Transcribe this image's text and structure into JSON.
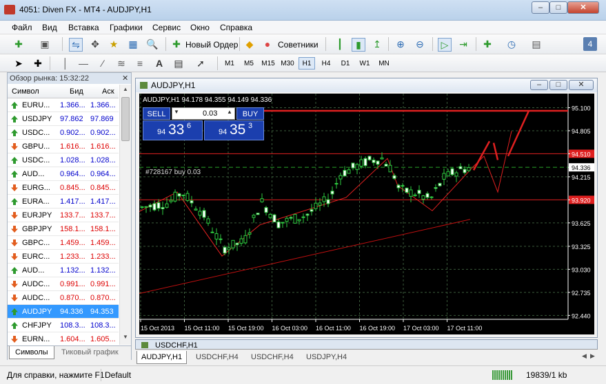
{
  "window": {
    "title": "4051: Diven FX - MT4 - AUDJPY,H1"
  },
  "menu": [
    "Файл",
    "Вид",
    "Вставка",
    "Графики",
    "Сервис",
    "Окно",
    "Справка"
  ],
  "toolbar": {
    "new_order": "Новый Ордер",
    "advisors": "Советники",
    "badge": "4"
  },
  "timeframes": [
    "M1",
    "M5",
    "M15",
    "M30",
    "H1",
    "H4",
    "D1",
    "W1",
    "MN"
  ],
  "active_timeframe": "H1",
  "market_watch": {
    "title": "Обзор рынка: 15:32:22",
    "headers": {
      "symbol": "Символ",
      "bid": "Бид",
      "ask": "Аск"
    },
    "rows": [
      {
        "symbol": "EURU...",
        "bid": "1.366...",
        "ask": "1.366...",
        "dir": "up",
        "color": "#0000cc"
      },
      {
        "symbol": "USDJPY",
        "bid": "97.862",
        "ask": "97.869",
        "dir": "up",
        "color": "#0000cc"
      },
      {
        "symbol": "USDC...",
        "bid": "0.902...",
        "ask": "0.902...",
        "dir": "up",
        "color": "#0000cc"
      },
      {
        "symbol": "GBPU...",
        "bid": "1.616...",
        "ask": "1.616...",
        "dir": "down",
        "color": "#dd0000"
      },
      {
        "symbol": "USDC...",
        "bid": "1.028...",
        "ask": "1.028...",
        "dir": "up",
        "color": "#0000cc"
      },
      {
        "symbol": "AUD...",
        "bid": "0.964...",
        "ask": "0.964...",
        "dir": "up",
        "color": "#0000cc"
      },
      {
        "symbol": "EURG...",
        "bid": "0.845...",
        "ask": "0.845...",
        "dir": "down",
        "color": "#dd0000"
      },
      {
        "symbol": "EURA...",
        "bid": "1.417...",
        "ask": "1.417...",
        "dir": "up",
        "color": "#0000cc"
      },
      {
        "symbol": "EURJPY",
        "bid": "133.7...",
        "ask": "133.7...",
        "dir": "down",
        "color": "#dd0000"
      },
      {
        "symbol": "GBPJPY",
        "bid": "158.1...",
        "ask": "158.1...",
        "dir": "down",
        "color": "#dd0000"
      },
      {
        "symbol": "GBPC...",
        "bid": "1.459...",
        "ask": "1.459...",
        "dir": "down",
        "color": "#dd0000"
      },
      {
        "symbol": "EURC...",
        "bid": "1.233...",
        "ask": "1.233...",
        "dir": "down",
        "color": "#dd0000"
      },
      {
        "symbol": "AUD...",
        "bid": "1.132...",
        "ask": "1.132...",
        "dir": "up",
        "color": "#0000cc"
      },
      {
        "symbol": "AUDC...",
        "bid": "0.991...",
        "ask": "0.991...",
        "dir": "down",
        "color": "#dd0000"
      },
      {
        "symbol": "AUDC...",
        "bid": "0.870...",
        "ask": "0.870...",
        "dir": "down",
        "color": "#dd0000"
      },
      {
        "symbol": "AUDJPY",
        "bid": "94.336",
        "ask": "94.353",
        "dir": "up",
        "color": "#ffffff",
        "selected": true
      },
      {
        "symbol": "CHFJPY",
        "bid": "108.3...",
        "ask": "108.3...",
        "dir": "up",
        "color": "#0000cc"
      },
      {
        "symbol": "EURN...",
        "bid": "1.604...",
        "ask": "1.605...",
        "dir": "down",
        "color": "#dd0000"
      }
    ],
    "tabs": [
      "Символы",
      "Тиковый график"
    ]
  },
  "chart": {
    "window_title": "AUDJPY,H1",
    "info": "AUDJPY,H1  94.178 94.355 94.149 94.336",
    "sell_label": "SELL",
    "buy_label": "BUY",
    "lot": "0.03",
    "sell_price_prefix": "94",
    "sell_price_big": "33",
    "sell_price_sup": "6",
    "buy_price_prefix": "94",
    "buy_price_big": "35",
    "buy_price_sup": "3",
    "order_label": "#728167 buy 0.03",
    "price_labels": [
      "95.100",
      "94.805",
      "94.510",
      "94.336",
      "94.215",
      "93.920",
      "93.625",
      "93.325",
      "93.030",
      "92.735",
      "92.440"
    ],
    "time_labels": [
      "15 Oct 2013",
      "15 Oct 11:00",
      "15 Oct 19:00",
      "16 Oct 03:00",
      "16 Oct 11:00",
      "16 Oct 19:00",
      "17 Oct 03:00",
      "17 Oct 11:00"
    ]
  },
  "second_chart_title": "USDCHF,H1",
  "chart_tabs": [
    "AUDJPY,H1",
    "USDCHF,H4",
    "USDCHF,H4",
    "USDJPY,H4"
  ],
  "status": {
    "help": "Для справки, нажмите F1",
    "profile": "Default",
    "traffic": "19839/1 kb"
  }
}
